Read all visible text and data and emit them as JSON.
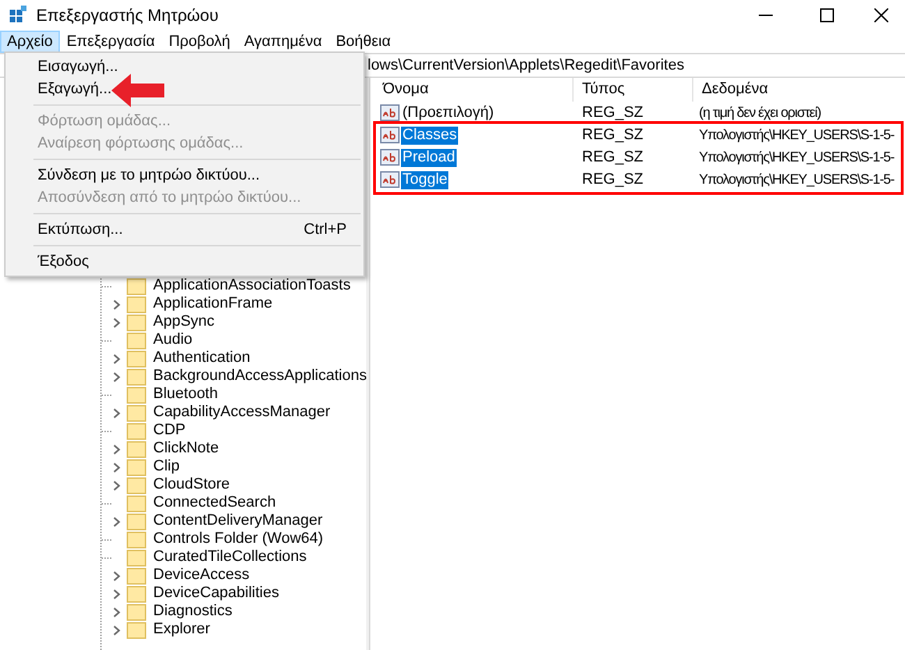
{
  "window": {
    "title": "Επεξεργαστής Μητρώου"
  },
  "menu_bar": [
    {
      "label": "Αρχείο",
      "selected": true
    },
    {
      "label": "Επεξεργασία",
      "selected": false
    },
    {
      "label": "Προβολή",
      "selected": false
    },
    {
      "label": "Αγαπημένα",
      "selected": false
    },
    {
      "label": "Βοήθεια",
      "selected": false
    }
  ],
  "file_menu": [
    {
      "kind": "item",
      "label": "Εισαγωγή...",
      "disabled": false
    },
    {
      "kind": "item",
      "label": "Εξαγωγή...",
      "disabled": false
    },
    {
      "kind": "separator"
    },
    {
      "kind": "item",
      "label": "Φόρτωση ομάδας...",
      "disabled": true
    },
    {
      "kind": "item",
      "label": "Αναίρεση φόρτωσης ομάδας...",
      "disabled": true
    },
    {
      "kind": "separator"
    },
    {
      "kind": "item",
      "label": "Σύνδεση με το μητρώο δικτύου...",
      "disabled": false
    },
    {
      "kind": "item",
      "label": "Αποσύνδεση από το μητρώο δικτύου...",
      "disabled": true
    },
    {
      "kind": "separator"
    },
    {
      "kind": "item",
      "label": "Εκτύπωση...",
      "shortcut": "Ctrl+P",
      "disabled": false
    },
    {
      "kind": "separator"
    },
    {
      "kind": "item",
      "label": "Έξοδος",
      "disabled": false
    }
  ],
  "address_bar": "lows\\CurrentVersion\\Applets\\Regedit\\Favorites",
  "tree": [
    {
      "label": "ApplicationAssociationToasts",
      "expandable": false
    },
    {
      "label": "ApplicationFrame",
      "expandable": true
    },
    {
      "label": "AppSync",
      "expandable": true
    },
    {
      "label": "Audio",
      "expandable": false
    },
    {
      "label": "Authentication",
      "expandable": true
    },
    {
      "label": "BackgroundAccessApplications",
      "expandable": true
    },
    {
      "label": "Bluetooth",
      "expandable": false
    },
    {
      "label": "CapabilityAccessManager",
      "expandable": true
    },
    {
      "label": "CDP",
      "expandable": false
    },
    {
      "label": "ClickNote",
      "expandable": true
    },
    {
      "label": "Clip",
      "expandable": true
    },
    {
      "label": "CloudStore",
      "expandable": true
    },
    {
      "label": "ConnectedSearch",
      "expandable": false
    },
    {
      "label": "ContentDeliveryManager",
      "expandable": true
    },
    {
      "label": "Controls Folder (Wow64)",
      "expandable": false
    },
    {
      "label": "CuratedTileCollections",
      "expandable": false
    },
    {
      "label": "DeviceAccess",
      "expandable": true
    },
    {
      "label": "DeviceCapabilities",
      "expandable": true
    },
    {
      "label": "Diagnostics",
      "expandable": true
    },
    {
      "label": "Explorer",
      "expandable": true
    }
  ],
  "columns": [
    "Όνομα",
    "Τύπος",
    "Δεδομένα"
  ],
  "values": [
    {
      "name": "(Προεπιλογή)",
      "type": "REG_SZ",
      "data": "(η τιμή δεν έχει οριστεί)",
      "selected": false
    },
    {
      "name": "Classes",
      "type": "REG_SZ",
      "data": "Υπολογιστής\\HKEY_USERS\\S-1-5-",
      "selected": true
    },
    {
      "name": "Preload",
      "type": "REG_SZ",
      "data": "Υπολογιστής\\HKEY_USERS\\S-1-5-",
      "selected": true
    },
    {
      "name": "Toggle",
      "type": "REG_SZ",
      "data": "Υπολογιστής\\HKEY_USERS\\S-1-5-",
      "selected": true
    }
  ]
}
